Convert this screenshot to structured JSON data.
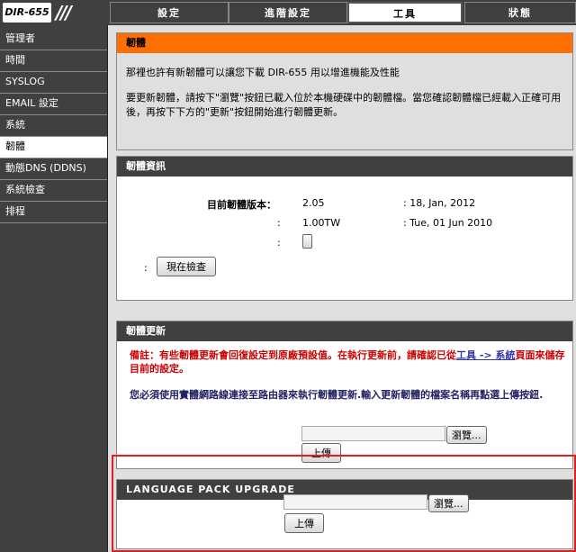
{
  "header": {
    "logo": "DIR-655",
    "slashes": "///",
    "tabs": [
      {
        "label": "設定"
      },
      {
        "label": "進階設定"
      },
      {
        "label": "工具"
      },
      {
        "label": "狀態"
      }
    ]
  },
  "sidebar": {
    "items": [
      {
        "label": "管理者"
      },
      {
        "label": "時間"
      },
      {
        "label": "SYSLOG"
      },
      {
        "label": "EMAIL 設定"
      },
      {
        "label": "系統"
      },
      {
        "label": "韌體"
      },
      {
        "label": "動態DNS (DDNS)"
      },
      {
        "label": "系統檢查"
      },
      {
        "label": "排程"
      }
    ]
  },
  "firmware_intro": {
    "title": "韌體",
    "line1": "那裡也許有新韌體可以讓您下載 DIR-655 用以增進機能及性能",
    "line2": "要更新韌體，請按下\"瀏覽\"按鈕已載入位於本機硬碟中的韌體檔。當您確認韌體檔已經載入正確可用後，再按下下方的\"更新\"按鈕開始進行韌體更新。"
  },
  "firmware_info": {
    "title": "韌體資訊",
    "current_label": "目前韌體版本：",
    "version": "2.05",
    "version_date": ": 18, Jan, 2012",
    "colon": ":",
    "lang_version": "1.00TW",
    "lang_date": ": Tue, 01 Jun 2010",
    "check_prefix": ":",
    "check_button": "現在檢查"
  },
  "firmware_update": {
    "title": "韌體更新",
    "note": "備註：有些韌體更新會回復設定到原廠預設值。在執行更新前，請確認已從",
    "note_link": "工具 -> 系統",
    "note_tail": "頁面來儲存目前的設定。",
    "instructions": "您必須使用實體網路線連接至路由器來執行韌體更新.輸入更新韌體的檔案名稱再點選上傳按鈕.",
    "browse_button": "瀏覽...",
    "upload_button": "上傳"
  },
  "language_pack": {
    "title": "LANGUAGE PACK UPGRADE",
    "browse_button": "瀏覽...",
    "upload_button": "上傳"
  }
}
